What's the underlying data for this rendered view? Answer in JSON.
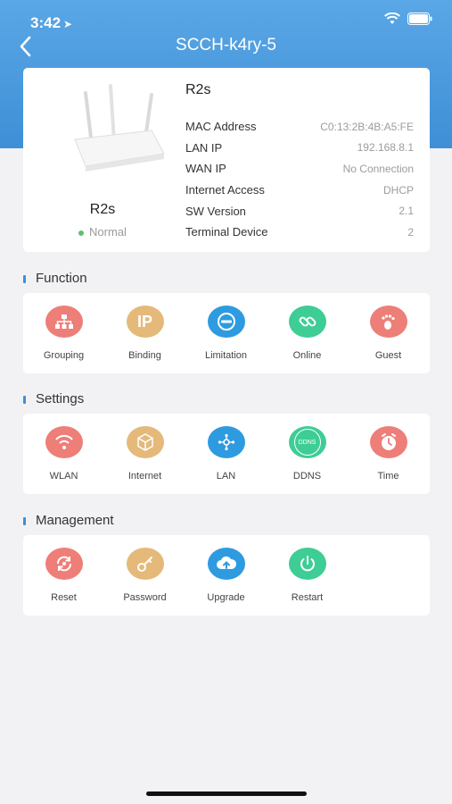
{
  "status_bar": {
    "time": "3:42"
  },
  "header": {
    "title": "SCCH-k4ry-5"
  },
  "device": {
    "name": "R2s",
    "status": "Normal",
    "model": "R2s",
    "info": [
      {
        "label": "MAC Address",
        "value": "C0:13:2B:4B:A5:FE"
      },
      {
        "label": "LAN IP",
        "value": "192.168.8.1"
      },
      {
        "label": "WAN IP",
        "value": "No Connection"
      },
      {
        "label": "Internet Access",
        "value": "DHCP"
      },
      {
        "label": "SW Version",
        "value": "2.1"
      },
      {
        "label": "Terminal Device",
        "value": "2"
      }
    ]
  },
  "sections": [
    {
      "title": "Function",
      "items": [
        {
          "label": "Grouping",
          "icon": "grouping-icon",
          "color": "#ee7e78"
        },
        {
          "label": "Binding",
          "icon": "ip-binding-icon",
          "color": "#e4b97a"
        },
        {
          "label": "Limitation",
          "icon": "limitation-icon",
          "color": "#2e9be0"
        },
        {
          "label": "Online",
          "icon": "link-icon",
          "color": "#3ecd95"
        },
        {
          "label": "Guest",
          "icon": "footprint-icon",
          "color": "#ee7e78"
        }
      ]
    },
    {
      "title": "Settings",
      "items": [
        {
          "label": "WLAN",
          "icon": "wifi-icon",
          "color": "#ee7e78"
        },
        {
          "label": "Internet",
          "icon": "cube-icon",
          "color": "#e4b97a"
        },
        {
          "label": "LAN",
          "icon": "lan-icon",
          "color": "#2e9be0"
        },
        {
          "label": "DDNS",
          "icon": "ddns-icon",
          "color": "#3ecd95"
        },
        {
          "label": "Time",
          "icon": "clock-icon",
          "color": "#ee7e78"
        }
      ]
    },
    {
      "title": "Management",
      "items": [
        {
          "label": "Reset",
          "icon": "reset-icon",
          "color": "#ee7e78"
        },
        {
          "label": "Password",
          "icon": "key-icon",
          "color": "#e4b97a"
        },
        {
          "label": "Upgrade",
          "icon": "cloud-upload-icon",
          "color": "#2e9be0"
        },
        {
          "label": "Restart",
          "icon": "power-icon",
          "color": "#3ecd95"
        }
      ]
    }
  ],
  "ddns_icon_text": "DDNS",
  "ip_icon_text": "IP"
}
